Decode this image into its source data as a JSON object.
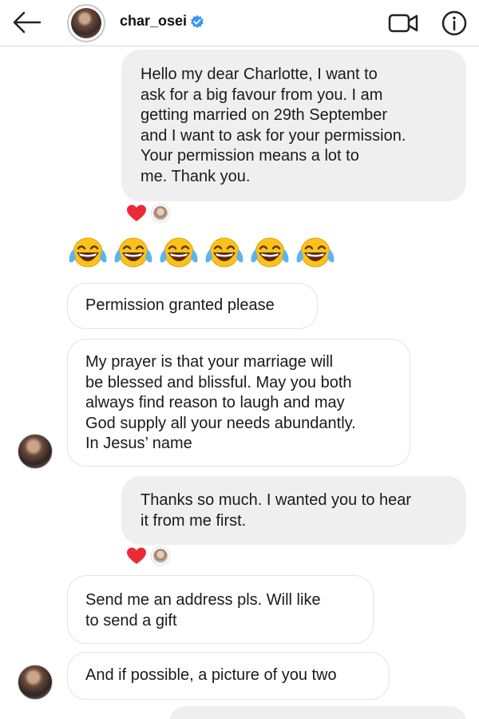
{
  "header": {
    "username": "char_osei"
  },
  "messages": [
    {
      "from": "me",
      "text": "Hello my dear Charlotte, I want to\nask for a big favour from you. I am\ngetting married on 29th September\nand I want to ask for your permission.\nYour permission means a lot to\nme. Thank you."
    },
    {
      "from": "them",
      "text": "😂😂😂😂😂😂"
    },
    {
      "from": "them",
      "text": "Permission granted please"
    },
    {
      "from": "them",
      "text": "My prayer is that your marriage will\nbe blessed and blissful. May you both\nalways find reason to laugh and may\nGod supply all your needs abundantly.\nIn Jesus’ name"
    },
    {
      "from": "me",
      "text": "Thanks so much. I wanted you to hear\nit from me first."
    },
    {
      "from": "them",
      "text": "Send me an address pls. Will like\nto send a gift"
    },
    {
      "from": "them",
      "text": "And if possible, a picture of you two"
    }
  ],
  "reactions": [
    {
      "emoji": "heart",
      "color": "#ed2938"
    },
    {
      "emoji": "heart",
      "color": "#ed2938"
    }
  ],
  "colors": {
    "sent_bubble": "#efefef",
    "received_border": "#e3e3e3",
    "verified": "#3897f0",
    "heart": "#ed2938"
  },
  "icons": [
    "back-arrow-icon",
    "verified-badge-icon",
    "video-call-icon",
    "info-icon",
    "heart-icon",
    "laughing-crying-emoji-icon"
  ]
}
